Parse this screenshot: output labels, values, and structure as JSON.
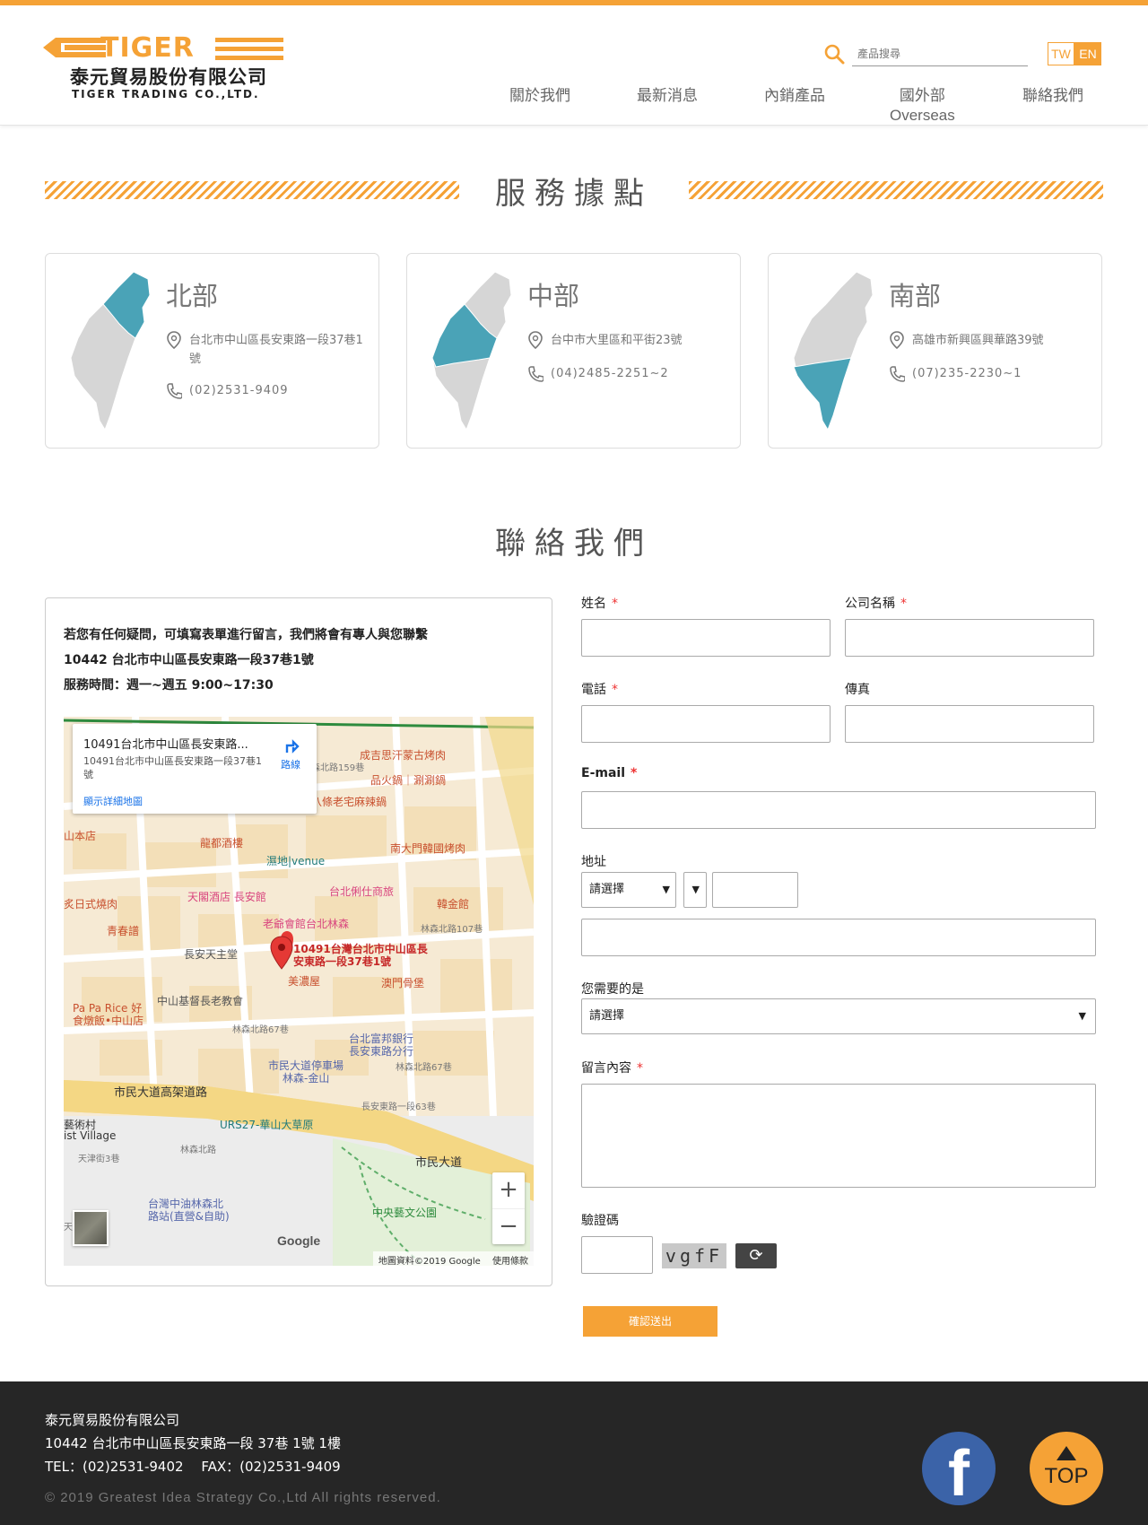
{
  "brand": {
    "logo_word": "TIGER",
    "company_cn": "泰元貿易股份有限公司",
    "company_en": "TIGER TRADING CO.,LTD.",
    "accent": "#f5a236"
  },
  "header": {
    "search_placeholder": "產品搜尋",
    "lang_tw": "TW",
    "lang_en": "EN",
    "nav": [
      {
        "label": "關於我們"
      },
      {
        "label": "最新消息"
      },
      {
        "label": "內銷產品"
      },
      {
        "label": "國外部",
        "sub": "Overseas"
      },
      {
        "label": "聯絡我們"
      }
    ]
  },
  "locations": {
    "title": "服務據點",
    "items": [
      {
        "name": "北部",
        "address": "台北市中山區長安東路一段37巷1號",
        "tel": "(02)2531-9409"
      },
      {
        "name": "中部",
        "address": "台中市大里區和平街23號",
        "tel": "(04)2485-2251~2"
      },
      {
        "name": "南部",
        "address": "高雄市新興區興華路39號",
        "tel": "(07)235-2230~1"
      }
    ]
  },
  "contact": {
    "title": "聯絡我們",
    "intro": "若您有任何疑問，可填寫表單進行留言，我們將會有專人與您聯繫",
    "address": "10442 台北市中山區長安東路一段37巷1號",
    "hours": "服務時間：週一~週五 9:00~17:30"
  },
  "map": {
    "card_title": "10491台北市中山區長安東路...",
    "card_address": "10491台北市中山區長安東路一段37巷1號",
    "card_link": "顯示詳細地圖",
    "route_label": "路線",
    "pin_label": "10491台灣台北市中山區長安東路一段37巷1號",
    "google": "Google",
    "attribution": "地圖資料©2019 Google",
    "terms": "使用條款",
    "zoom_in": "+",
    "zoom_out": "−",
    "labels": [
      {
        "text": "成吉思汗蒙古烤肉",
        "color": "#c8502e"
      },
      {
        "text": "品火鍋｜涮涮鍋",
        "color": "#c8502e"
      },
      {
        "text": "八條老宅麻辣鍋",
        "color": "#c8502e"
      },
      {
        "text": "林森北路159巷",
        "color": "#777"
      },
      {
        "text": "山本店",
        "color": "#c8502e"
      },
      {
        "text": "龍都酒樓",
        "color": "#c8502e"
      },
      {
        "text": "濕地|venue",
        "color": "#207a7a"
      },
      {
        "text": "南大門韓國烤肉",
        "color": "#c8502e"
      },
      {
        "text": "天閣酒店 長安館",
        "color": "#d9457e"
      },
      {
        "text": "台北俐仕商旅",
        "color": "#d9457e"
      },
      {
        "text": "韓金館",
        "color": "#c8502e"
      },
      {
        "text": "炙日式燒肉",
        "color": "#c8502e"
      },
      {
        "text": "老爺會館台北林森",
        "color": "#d9457e"
      },
      {
        "text": "林森北路107巷",
        "color": "#777"
      },
      {
        "text": "青春譜",
        "color": "#c8502e"
      },
      {
        "text": "長安天主堂",
        "color": "#555"
      },
      {
        "text": "美濃屋",
        "color": "#c8502e"
      },
      {
        "text": "澳門骨堡",
        "color": "#c8502e"
      },
      {
        "text": "Pa Pa Rice 好",
        "color": "#c8502e"
      },
      {
        "text": "食燉飯•中山店",
        "color": "#c8502e"
      },
      {
        "text": "中山基督長老教會",
        "color": "#555"
      },
      {
        "text": "林森北路67巷",
        "color": "#777"
      },
      {
        "text": "台北富邦銀行",
        "color": "#5566aa"
      },
      {
        "text": "長安東路分行",
        "color": "#5566aa"
      },
      {
        "text": "市民大道停車場",
        "color": "#5566aa"
      },
      {
        "text": "林森-金山",
        "color": "#5566aa"
      },
      {
        "text": "林森北路67巷",
        "color": "#777"
      },
      {
        "text": "市民大道高架道路",
        "color": "#333"
      },
      {
        "text": "長安東路一段63巷",
        "color": "#777"
      },
      {
        "text": "藝術村",
        "color": "#333"
      },
      {
        "text": "ist Village",
        "color": "#333"
      },
      {
        "text": "URS27-華山大草原",
        "color": "#207a7a"
      },
      {
        "text": "天津街3巷",
        "color": "#777"
      },
      {
        "text": "林森北路",
        "color": "#777"
      },
      {
        "text": "市民大道",
        "color": "#333"
      },
      {
        "text": "台灣中油林森北",
        "color": "#5566aa"
      },
      {
        "text": "路站(直營&自助)",
        "color": "#5566aa"
      },
      {
        "text": "中央藝文公園",
        "color": "#2e8b3e"
      },
      {
        "text": "天津街",
        "color": "#777"
      }
    ]
  },
  "form": {
    "name_label": "姓名",
    "company_label": "公司名稱",
    "phone_label": "電話",
    "fax_label": "傳真",
    "email_label": "E-mail",
    "address_label": "地址",
    "city_select": "請選擇",
    "need_label": "您需要的是",
    "need_select": "請選擇",
    "message_label": "留言內容",
    "captcha_label": "驗證碼",
    "captcha_text": "vgfF",
    "refresh_icon": "⟳",
    "required_mark": "*",
    "submit_label": "確認送出",
    "dropdown_arrow": "▼"
  },
  "footer": {
    "company": "泰元貿易股份有限公司",
    "address": "10442 台北市中山區長安東路一段 37巷 1號 1樓",
    "contact": "TEL：(02)2531-9402　 FAX：(02)2531-9409",
    "copyright": "© 2019 Greatest Idea Strategy Co.,Ltd All rights reserved.",
    "facebook_glyph": "f",
    "top_label": "TOP"
  }
}
